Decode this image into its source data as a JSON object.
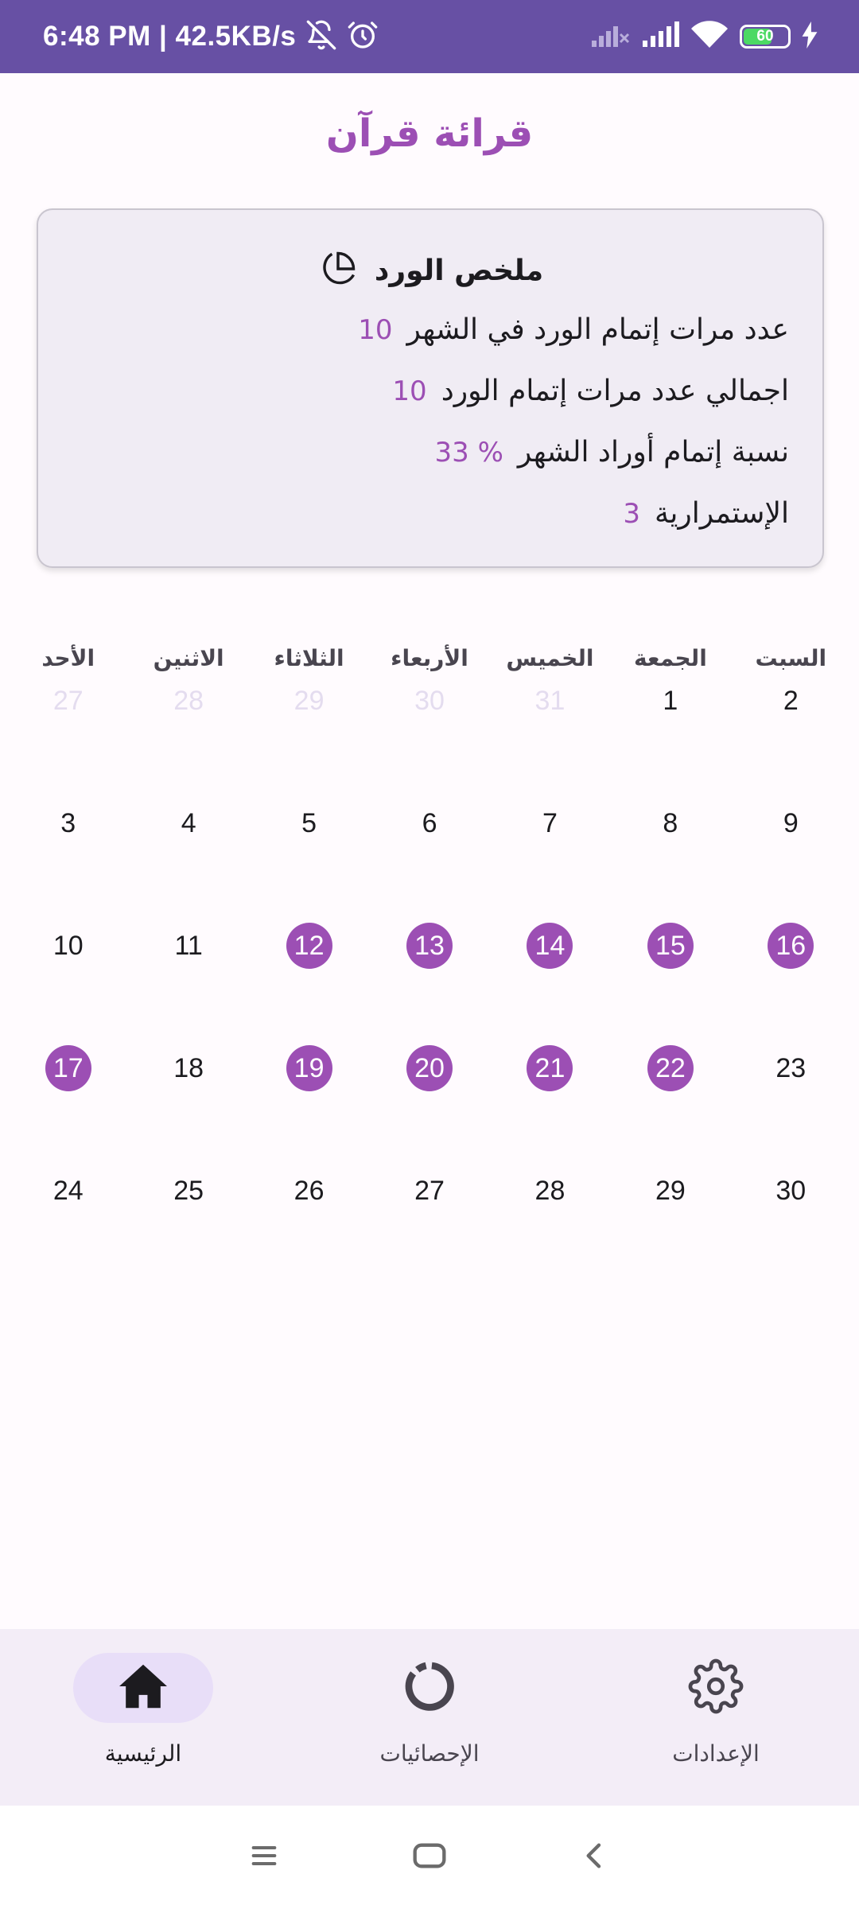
{
  "status_bar": {
    "time_speed": "6:48 PM | 42.5KB/s",
    "battery_level": "60",
    "icons": [
      "bell-muted-icon",
      "alarm-icon",
      "signal-icon",
      "signal-icon",
      "wifi-icon",
      "battery-icon",
      "charging-icon"
    ]
  },
  "app": {
    "title": "قرائة قرآن"
  },
  "summary": {
    "title": "ملخص الورد",
    "icon": "pie-chart-icon",
    "rows": [
      {
        "label": "عدد مرات إتمام الورد في الشهر",
        "value": "10"
      },
      {
        "label": "اجمالي عدد مرات إتمام الورد",
        "value": "10"
      },
      {
        "label": "نسبة إتمام أوراد الشهر",
        "value": "% 33"
      },
      {
        "label": "الإستمرارية",
        "value": "3"
      }
    ]
  },
  "calendar": {
    "weekdays": [
      "السبت",
      "الجمعة",
      "الخميس",
      "الأربعاء",
      "الثلاثاء",
      "الاثنين",
      "الأحد"
    ],
    "weeks": [
      [
        {
          "d": "2"
        },
        {
          "d": "1"
        },
        {
          "d": "31",
          "muted": true
        },
        {
          "d": "30",
          "muted": true
        },
        {
          "d": "29",
          "muted": true
        },
        {
          "d": "28",
          "muted": true
        },
        {
          "d": "27",
          "muted": true
        }
      ],
      [
        {
          "d": "9"
        },
        {
          "d": "8"
        },
        {
          "d": "7"
        },
        {
          "d": "6"
        },
        {
          "d": "5"
        },
        {
          "d": "4"
        },
        {
          "d": "3"
        }
      ],
      [
        {
          "d": "16",
          "done": true
        },
        {
          "d": "15",
          "done": true
        },
        {
          "d": "14",
          "done": true
        },
        {
          "d": "13",
          "done": true
        },
        {
          "d": "12",
          "done": true
        },
        {
          "d": "11"
        },
        {
          "d": "10"
        }
      ],
      [
        {
          "d": "23"
        },
        {
          "d": "22",
          "done": true
        },
        {
          "d": "21",
          "done": true
        },
        {
          "d": "20",
          "done": true
        },
        {
          "d": "19",
          "done": true
        },
        {
          "d": "18"
        },
        {
          "d": "17",
          "done": true
        }
      ],
      [
        {
          "d": "30"
        },
        {
          "d": "29"
        },
        {
          "d": "28"
        },
        {
          "d": "27"
        },
        {
          "d": "26"
        },
        {
          "d": "25"
        },
        {
          "d": "24"
        }
      ]
    ]
  },
  "bottom_nav": {
    "items": [
      {
        "label": "الرئيسية",
        "icon": "home-icon",
        "active": true
      },
      {
        "label": "الإحصائيات",
        "icon": "stats-ring-icon",
        "active": false
      },
      {
        "label": "الإعدادات",
        "icon": "gear-icon",
        "active": false
      }
    ]
  },
  "colors": {
    "primary": "#6750a4",
    "accent": "#9c4fb4",
    "card_bg": "#f0ecf4",
    "nav_bg": "#f3edf7",
    "active_pill": "#e8def8"
  }
}
